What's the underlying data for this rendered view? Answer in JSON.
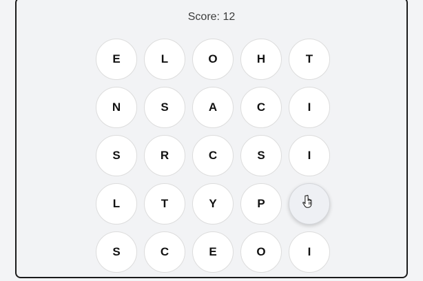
{
  "game": {
    "score_label": "Score: 12"
  },
  "grid": {
    "letters": [
      [
        "E",
        "L",
        "O",
        "H",
        "T"
      ],
      [
        "N",
        "S",
        "A",
        "C",
        "I"
      ],
      [
        "S",
        "R",
        "C",
        "S",
        "I"
      ],
      [
        "L",
        "T",
        "Y",
        "P",
        ""
      ],
      [
        "S",
        "C",
        "E",
        "O",
        "I"
      ]
    ],
    "hovered": {
      "row": 3,
      "col": 4
    }
  },
  "colors": {
    "tile_bg": "#ffffff",
    "tile_hover_bg": "#eef0f4",
    "frame_border": "#1a1a1a",
    "page_bg": "#f3f4f6"
  },
  "icons": {
    "cursor": "hand-pointer-icon"
  }
}
